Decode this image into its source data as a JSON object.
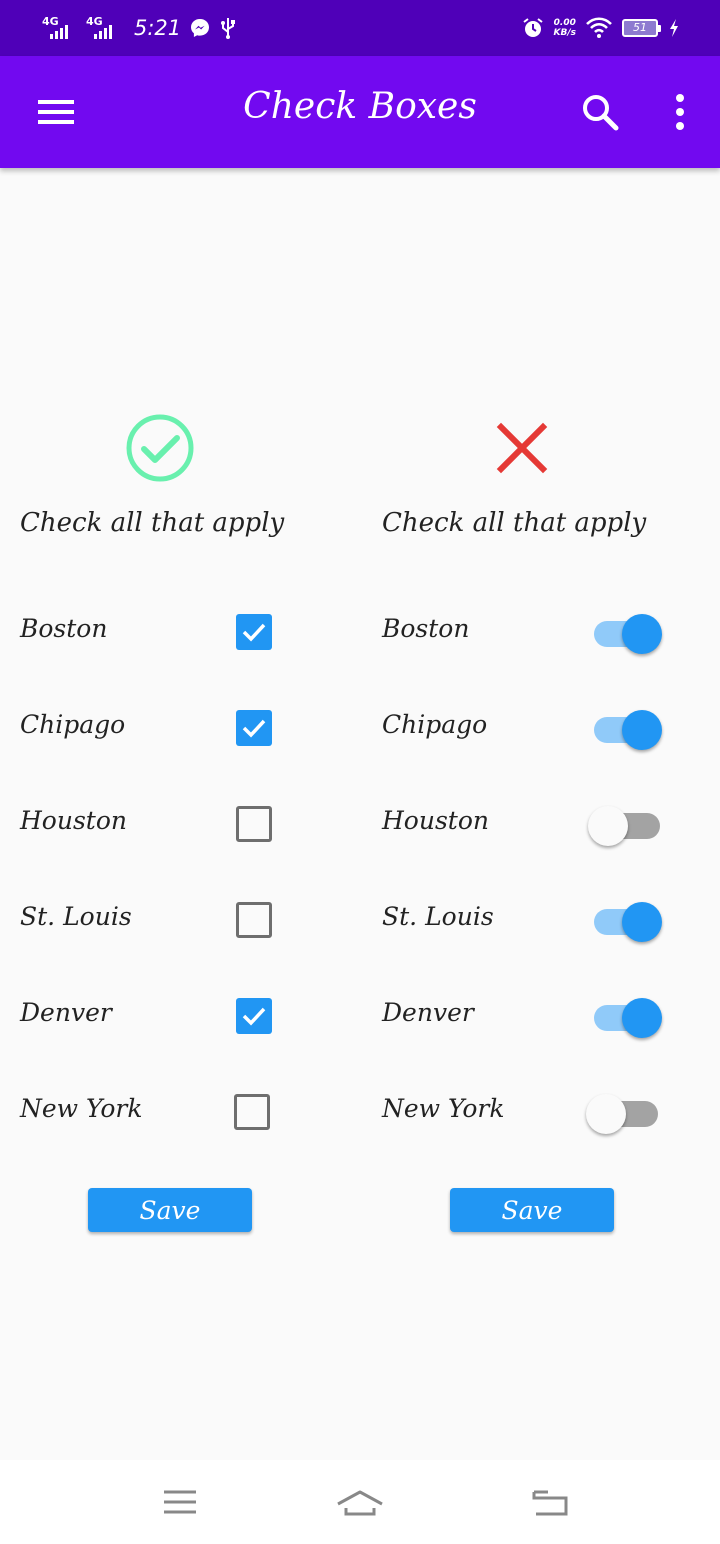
{
  "status_bar": {
    "signal_1": "4G",
    "signal_2": "4G",
    "time": "5:21",
    "net_speed_value": "0.00",
    "net_speed_unit": "KB/s",
    "battery": "51",
    "icons": [
      "messenger-icon",
      "usb-icon",
      "alarm-icon",
      "wifi-icon",
      "battery-icon",
      "charging-icon"
    ]
  },
  "app_bar": {
    "title": "Check Boxes",
    "icons": [
      "hamburger-menu-icon",
      "search-icon",
      "more-vert-icon"
    ]
  },
  "left_column": {
    "icon": "check-circle-icon",
    "icon_color": "#69f0ae",
    "heading": "Check all that apply",
    "items": [
      {
        "label": "Boston",
        "checked": true
      },
      {
        "label": "Chipago",
        "checked": true
      },
      {
        "label": "Houston",
        "checked": false
      },
      {
        "label": "St. Louis",
        "checked": false
      },
      {
        "label": "Denver",
        "checked": true
      },
      {
        "label": "New York",
        "checked": false
      }
    ],
    "save_label": "Save"
  },
  "right_column": {
    "icon": "close-icon",
    "icon_color": "#e53935",
    "heading": "Check all that apply",
    "items": [
      {
        "label": "Boston",
        "on": true
      },
      {
        "label": "Chipago",
        "on": true
      },
      {
        "label": "Houston",
        "on": false
      },
      {
        "label": "St. Louis",
        "on": true
      },
      {
        "label": "Denver",
        "on": true
      },
      {
        "label": "New York",
        "on": false
      }
    ],
    "save_label": "Save"
  },
  "nav_bar": {
    "icons": [
      "recent-apps-icon",
      "home-icon",
      "back-icon"
    ]
  },
  "colors": {
    "status_bar": "#4f00b8",
    "app_bar": "#7209f0",
    "accent": "#2196f3"
  }
}
